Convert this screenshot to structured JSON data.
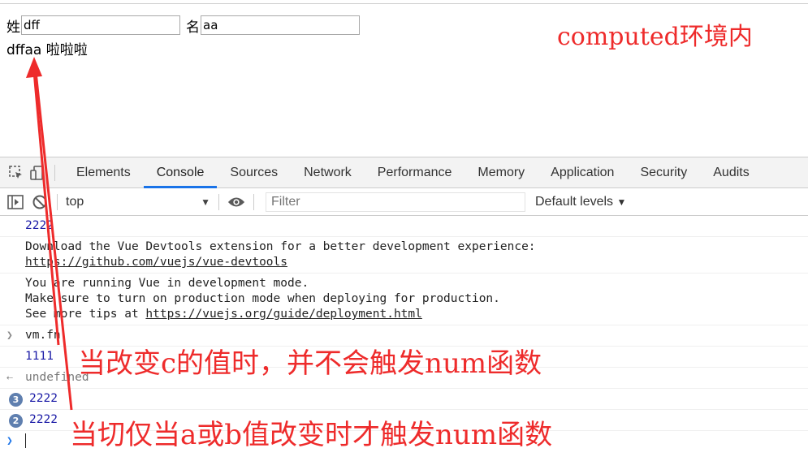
{
  "page": {
    "surname_label": "姓",
    "surname_value": "dff",
    "name_label": "名",
    "name_value": "aa",
    "result_text": "dffaa 啦啦啦"
  },
  "annotations": {
    "computed_note": "computed环境内",
    "note_c": "当改变c的值时，并不会触发num函数",
    "note_ab": "当切仅当a或b值改变时才触发num函数",
    "color": "#ee2b2b"
  },
  "devtools": {
    "tabs": [
      "Elements",
      "Console",
      "Sources",
      "Network",
      "Performance",
      "Memory",
      "Application",
      "Security",
      "Audits"
    ],
    "active_tab": "Console",
    "context": "top",
    "filter_placeholder": "Filter",
    "levels_label": "Default levels",
    "accent": "#1a73e8"
  },
  "console": {
    "line1": "2222",
    "devtools_msg": "Download the Vue Devtools extension for a better development experience:",
    "devtools_link": "https://github.com/vuejs/vue-devtools",
    "dev_mode_1": "You are running Vue in development mode.",
    "dev_mode_2": "Make sure to turn on production mode when deploying for production.",
    "dev_mode_3_prefix": "See more tips at ",
    "dev_mode_link": "https://vuejs.org/guide/deployment.html",
    "input_cmd": "vm.fn",
    "out_1111": "1111",
    "undefined": "undefined",
    "badge1_count": "3",
    "badge1_text": "2222",
    "badge2_count": "2",
    "badge2_text": "2222"
  }
}
